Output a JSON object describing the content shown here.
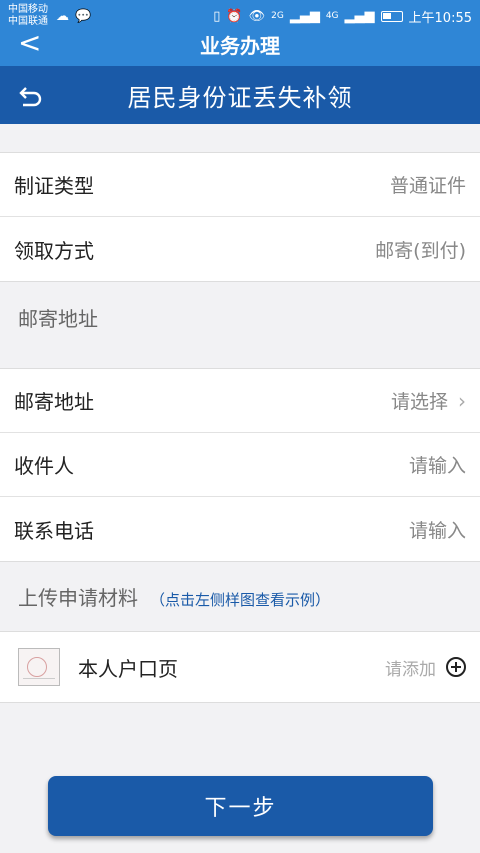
{
  "statusbar": {
    "carrier1": "中国移动",
    "carrier2": "中国联通",
    "network1": "2G",
    "network2": "4G",
    "time": "上午10:55"
  },
  "behind_header": {
    "back": "<",
    "title": "业务办理"
  },
  "header": {
    "title": "居民身份证丢失补领"
  },
  "card_type": {
    "label": "制证类型",
    "value": "普通证件"
  },
  "pickup": {
    "label": "领取方式",
    "value": "邮寄(到付)"
  },
  "mail_section": {
    "title": "邮寄地址"
  },
  "mail_address": {
    "label": "邮寄地址",
    "value": "请选择"
  },
  "recipient": {
    "label": "收件人",
    "value": "请输入"
  },
  "phone": {
    "label": "联系电话",
    "value": "请输入"
  },
  "upload_section": {
    "title": "上传申请材料",
    "note": "（点击左侧样图查看示例）"
  },
  "upload_item": {
    "label": "本人户口页",
    "action": "请添加"
  },
  "next_button": {
    "label": "下一步"
  },
  "colors": {
    "header": "#1a5aa8",
    "statusbar": "#2f86d6"
  }
}
